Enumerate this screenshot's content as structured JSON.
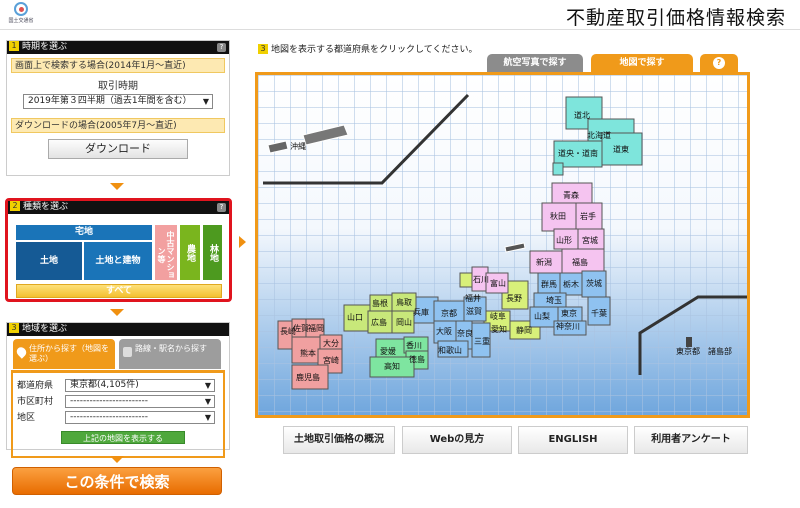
{
  "header": {
    "logo_text": "国土交通省",
    "title": "不動産取引価格情報検索"
  },
  "step1": {
    "num": "1",
    "title": "時期を選ぶ",
    "screen_label": "画面上で検索する場合(2014年1月～直近)",
    "period_label": "取引時期",
    "period_value": "2019年第３四半期（過去1年間を含む）",
    "download_label": "ダウンロードの場合(2005年7月～直近)",
    "download_button": "ダウンロード"
  },
  "step2": {
    "num": "2",
    "title": "種類を選ぶ",
    "takuchi": "宅地",
    "tochi": "土地",
    "tochi_tatemono": "土地と建物",
    "mansion": "中古マンション等",
    "nochi": "農地",
    "rinchi": "林地",
    "all": "すべて"
  },
  "step3": {
    "num": "3",
    "title": "地域を選ぶ",
    "tab_address": "住所から探す（地図を選ぶ）",
    "tab_station": "路線・駅名から探す",
    "pref_label": "都道府県",
    "pref_value": "東京都(4,105件)",
    "city_label": "市区町村",
    "city_value": "------------------------",
    "district_label": "地区",
    "district_value": "------------------------",
    "show_map_button": "上記の地図を表示する"
  },
  "search_button": "この条件で検索",
  "map": {
    "num": "3",
    "caption": "地図を表示する都道府県をクリックしてください。",
    "tab_aerial": "航空写真で探す",
    "tab_map": "地図で探す",
    "tab_help": "?",
    "labels": {
      "okinawa": "沖縄",
      "hokkaido_north": "道北",
      "hokkaido_central": "北海道",
      "hokkaido_south": "道央・道南",
      "hokkaido_east": "道東",
      "aomori": "青森",
      "akita": "秋田",
      "iwate": "岩手",
      "yamagata": "山形",
      "miyagi": "宮城",
      "niigata": "新潟",
      "fukushima": "福島",
      "ishikawa": "石川",
      "toyama": "富山",
      "fukui": "福井",
      "gunma": "群馬",
      "tochigi": "栃木",
      "ibaraki": "茨城",
      "nagano": "長野",
      "saitama": "埼玉",
      "tokyo": "東京",
      "chiba": "千葉",
      "kanagawa": "神奈川",
      "yamanashi": "山梨",
      "gifu": "岐阜",
      "shizuoka": "静岡",
      "aichi": "愛知",
      "shiga": "滋賀",
      "kyoto": "京都",
      "hyogo": "兵庫",
      "osaka": "大阪",
      "nara": "奈良",
      "mie": "三重",
      "wakayama": "和歌山",
      "tottori": "鳥取",
      "shimane": "島根",
      "okayama": "岡山",
      "hiroshima": "広島",
      "yamaguchi": "山口",
      "kagawa": "香川",
      "tokushima": "徳島",
      "ehime": "愛媛",
      "kochi": "高知",
      "fukuoka": "福岡",
      "saga": "佐賀",
      "nagasaki": "長崎",
      "oita": "大分",
      "kumamoto": "熊本",
      "miyazaki": "宮崎",
      "kagoshima": "鹿児島",
      "tokyo_islands": "東京都　諸島部"
    }
  },
  "footer": {
    "overview": "土地取引価格の概況",
    "howto": "Webの見方",
    "english": "ENGLISH",
    "survey": "利用者アンケート"
  },
  "colors": {
    "accent_orange": "#f09a1a",
    "highlight_red": "#e0141e",
    "hokkaido": "#7ee5dc",
    "tohoku": "#f5c4f0",
    "kanto": "#8fc2f0",
    "chubu": "#d8f07a",
    "kinki": "#8fc2f0",
    "chugoku": "#c8e87a",
    "shikoku": "#7ee5a0",
    "kyushu": "#f0a0a0"
  }
}
